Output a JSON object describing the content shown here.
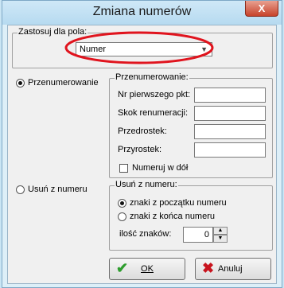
{
  "window": {
    "title": "Zmiana numerów",
    "close_glyph": "X"
  },
  "field_group": {
    "legend": "Zastosuj dla pola:",
    "selected_value": "Numer"
  },
  "mode_renumber": {
    "label": "Przenumerowanie",
    "selected": true
  },
  "renumber_group": {
    "legend": "Przenumerowanie:",
    "fields": [
      {
        "label": "Nr pierwszego pkt:",
        "value": ""
      },
      {
        "label": "Skok renumeracji:",
        "value": ""
      },
      {
        "label": "Przedrostek:",
        "value": ""
      },
      {
        "label": "Przyrostek:",
        "value": ""
      }
    ],
    "checkbox_label": "Numeruj w dół",
    "checkbox_checked": false
  },
  "mode_remove": {
    "label": "Usuń z numeru",
    "selected": false
  },
  "remove_group": {
    "legend": "Usuń z numeru:",
    "option_start": "znaki z początku numeru",
    "option_end": "znaki z końca numeru",
    "count_label": "ilość znaków:",
    "count_value": "0"
  },
  "buttons": {
    "ok_label": "OK",
    "cancel_label": "Anuluj"
  },
  "colors": {
    "highlight_ellipse": "#e0141e",
    "ok_icon": "#2e9d2e",
    "cancel_icon": "#c8141e"
  }
}
